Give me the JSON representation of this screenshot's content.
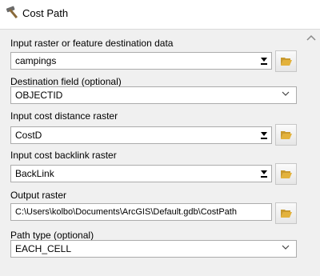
{
  "window": {
    "title": "Cost Path",
    "icon": "hammer-icon"
  },
  "fields": {
    "input_raster": {
      "label": "Input raster or feature destination data",
      "value": "campings"
    },
    "destination_field": {
      "label": "Destination field (optional)",
      "value": "OBJECTID"
    },
    "cost_distance": {
      "label": "Input cost distance raster",
      "value": "CostD"
    },
    "backlink": {
      "label": "Input cost backlink raster",
      "value": "BackLink"
    },
    "output_raster": {
      "label": "Output raster",
      "value": "C:\\Users\\kolbo\\Documents\\ArcGIS\\Default.gdb\\CostPath"
    },
    "path_type": {
      "label": "Path type (optional)",
      "value": "EACH_CELL"
    }
  },
  "icons": {
    "browse": "folder-open-icon",
    "dropdown": "dropdown-arrow-icon",
    "chevron": "chevron-down-icon",
    "scroll_up": "scroll-up-icon"
  },
  "colors": {
    "folder": "#e3b23c",
    "border": "#acacac"
  }
}
